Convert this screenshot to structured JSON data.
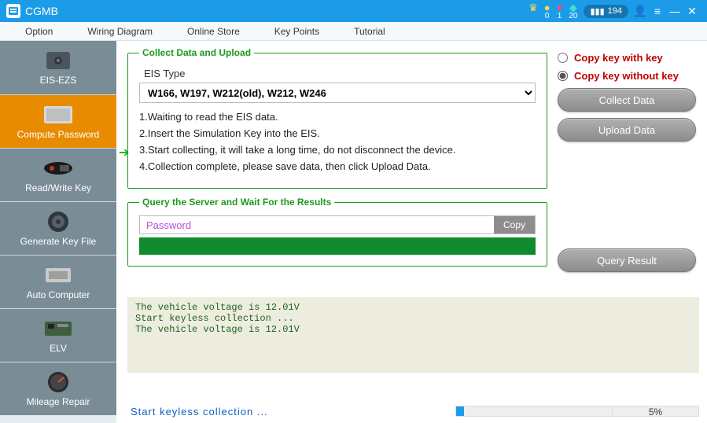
{
  "titlebar": {
    "app_name": "CGMB",
    "stats": {
      "crown": "",
      "yellow": "0",
      "red": "1",
      "teal": "20",
      "bars": "194"
    }
  },
  "menubar": {
    "items": [
      "Option",
      "Wiring Diagram",
      "Online Store",
      "Key Points",
      "Tutorial"
    ]
  },
  "sidebar": {
    "items": [
      {
        "label": "EIS-EZS"
      },
      {
        "label": "Compute Password"
      },
      {
        "label": "Read/Write Key"
      },
      {
        "label": "Generate Key File"
      },
      {
        "label": "Auto Computer"
      },
      {
        "label": "ELV"
      },
      {
        "label": "Mileage Repair"
      }
    ],
    "active_index": 1
  },
  "collect": {
    "legend": "Collect Data and Upload",
    "eis_type_label": "EIS Type",
    "eis_type_value": "W166,  W197,  W212(old),  W212,  W246",
    "steps": [
      "1.Waiting to read the EIS data.",
      "2.Insert the Simulation Key into the EIS.",
      "3.Start collecting, it will take a long time, do not disconnect the device.",
      "4.Collection complete, please save data, then click Upload Data."
    ],
    "current_step_index": 2
  },
  "query": {
    "legend": "Query the Server and Wait For the Results",
    "password_label": "Password",
    "copy_label": "Copy"
  },
  "right": {
    "radio_with": "Copy key with key",
    "radio_without": "Copy key without key",
    "radio_selected": "without",
    "collect_btn": "Collect Data",
    "upload_btn": "Upload Data",
    "query_btn": "Query Result"
  },
  "log": "The vehicle voltage is 12.01V\nStart keyless collection ...\nThe vehicle voltage is 12.01V",
  "status": {
    "text": "Start  keyless  collection  ...",
    "progress_pct": 5,
    "progress_label": "5%"
  }
}
